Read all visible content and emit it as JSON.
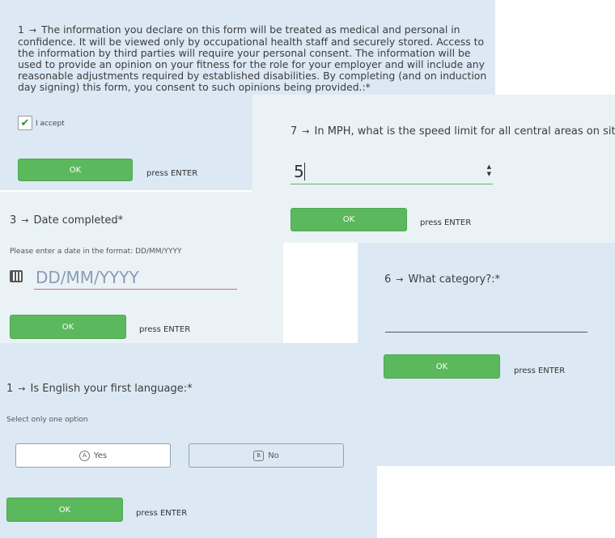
{
  "press_enter": "press ENTER",
  "arrow_glyph": "→",
  "consent": {
    "number": "1",
    "text": "The information you declare on this form will be treated as medical and personal in confidence. It will be viewed only by occupational health staff and securely stored. Access to the information by third parties will require your personal consent. The information will be used to provide an opinion on your fitness for the role for your employer and will include any reasonable adjustments required by established disabilities. By completing (and on induction day signing) this form, you consent to such opinions being provided.:*",
    "checkbox_label": "I accept",
    "checked": true,
    "ok_label": "OK"
  },
  "speed": {
    "number": "7",
    "question": "In MPH, what is the speed limit for all central areas on site?*",
    "value": "5",
    "ok_label": "OK"
  },
  "date": {
    "number": "3",
    "question": "Date completed*",
    "instruction": "Please enter a date in the format: DD/MM/YYYY",
    "placeholder": "DD/MM/YYYY",
    "ok_label": "OK"
  },
  "category": {
    "number": "6",
    "question": "What category?:*",
    "ok_label": "OK"
  },
  "language": {
    "number": "1",
    "question": "Is English your first language:*",
    "instruction": "Select only one option",
    "options": [
      {
        "key": "A",
        "label": "Yes"
      },
      {
        "key": "B",
        "label": "No"
      }
    ],
    "ok_label": "OK"
  },
  "colors": {
    "ok_green": "#5cb85c",
    "panel_blue": "#dce9f5",
    "panel_pale": "#eaf2f6",
    "input_error_red": "#e06666",
    "input_ok_green": "#5cb85c"
  },
  "icons": [
    "check-icon",
    "arrow-right-icon",
    "calendar-icon",
    "spinner-up-icon",
    "spinner-down-icon"
  ]
}
